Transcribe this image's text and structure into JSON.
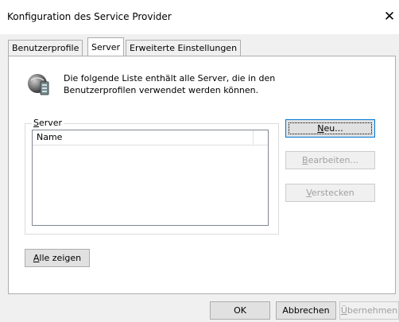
{
  "window": {
    "title": "Konfiguration des Service Provider",
    "close_label": "✕"
  },
  "tabs": [
    {
      "label": "Benutzerprofile"
    },
    {
      "label": "Server"
    },
    {
      "label": "Erweiterte Einstellungen"
    }
  ],
  "info": {
    "icon": "server-icon",
    "text": "Die folgende Liste enthält alle Server, die in den Benutzerprofilen verwendet werden können."
  },
  "server_group": {
    "legend_accel": "S",
    "legend_rest": "erver",
    "columns": [
      "Name"
    ],
    "rows": []
  },
  "buttons": {
    "neu": {
      "accel": "N",
      "rest": "eu..."
    },
    "bearbeiten": {
      "accel": "B",
      "rest": "earbeiten..."
    },
    "verstecken": {
      "accel": "V",
      "rest": "erstecken"
    },
    "alle_zeigen": {
      "accel": "A",
      "rest": "lle zeigen"
    },
    "ok": "OK",
    "abbrechen": "Abbrechen",
    "uebernehmen": {
      "accel": "Ü",
      "rest": "bernehmen"
    }
  }
}
